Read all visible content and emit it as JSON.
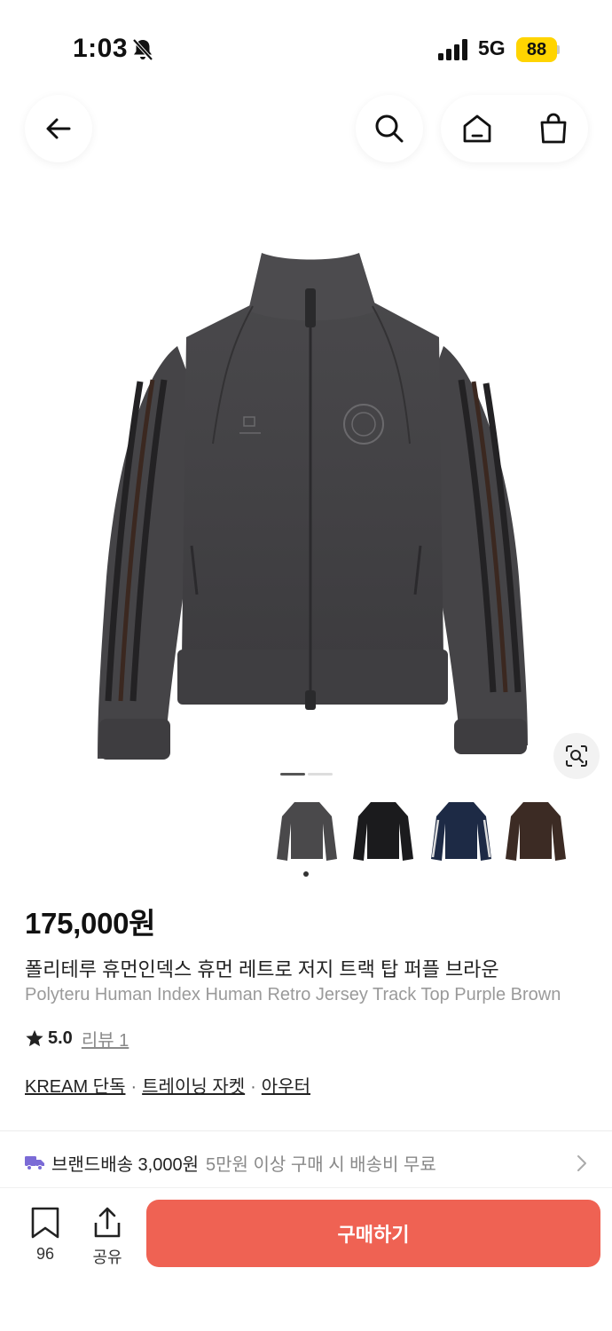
{
  "status_bar": {
    "time": "1:03",
    "network": "5G",
    "battery": "88"
  },
  "icons": {
    "back": "arrow-left-icon",
    "search": "search-icon",
    "home": "home-icon",
    "cart": "shopping-bag-icon",
    "lens": "image-search-icon",
    "star": "star-icon",
    "truck": "truck-icon",
    "bookmark": "bookmark-icon",
    "share": "share-icon",
    "chevron": "chevron-right-icon"
  },
  "colors": {
    "accent": "#ef6253",
    "shipping_icon": "#7b6bd6",
    "battery": "#ffd400"
  },
  "gallery": {
    "thumbnails": [
      {
        "color": "#4a494b",
        "label": "charcoal"
      },
      {
        "color": "#1b1b1d",
        "label": "black"
      },
      {
        "color": "#1d2a45",
        "label": "navy"
      },
      {
        "color": "#3c2b24",
        "label": "brown"
      }
    ]
  },
  "product": {
    "price": "175,000원",
    "title_ko": "폴리테루 휴먼인덱스 휴먼 레트로 저지 트랙 탑 퍼플 브라운",
    "title_en": "Polyteru Human Index Human Retro Jersey Track Top Purple Brown",
    "rating": "5.0",
    "review": "리뷰 1",
    "tags": [
      "KREAM 단독",
      "트레이닝 자켓",
      "아우터"
    ]
  },
  "shipping": {
    "label": "브랜드배송 3,000원",
    "note": "5만원 이상 구매 시 배송비 무료"
  },
  "bottom_bar": {
    "bookmark_count": "96",
    "share_label": "공유",
    "buy_label": "구매하기"
  }
}
